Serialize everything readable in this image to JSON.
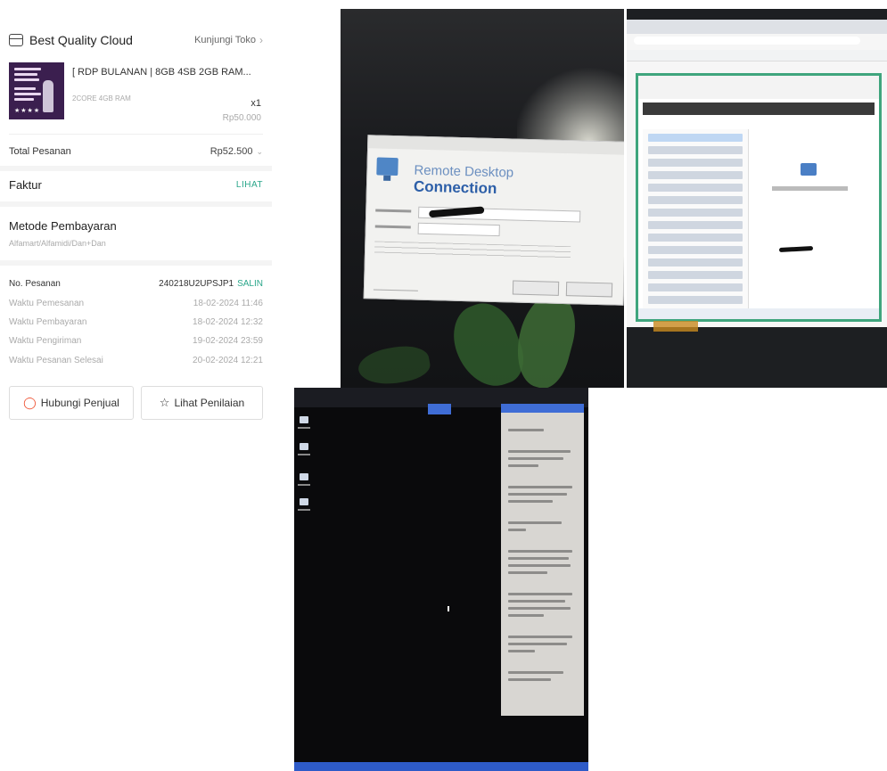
{
  "order": {
    "store_name": "Best Quality Cloud",
    "store_link": "Kunjungi Toko",
    "product": {
      "title": "[ RDP BULANAN | 8GB 4SB 2GB RAM...",
      "variation": "2CORE 4GB RAM",
      "quantity": "x1",
      "price": "Rp50.000"
    },
    "total_label": "Total Pesanan",
    "total_value": "Rp52.500",
    "invoice_label": "Faktur",
    "invoice_action": "LIHAT",
    "payment_title": "Metode Pembayaran",
    "payment_value": "Alfamart/Alfamidi/Dan+Dan",
    "order_info": [
      {
        "label": "No. Pesanan",
        "value": "240218U2UPSJP1"
      },
      {
        "label": "Waktu Pemesanan",
        "value": "18-02-2024 11:46"
      },
      {
        "label": "Waktu Pembayaran",
        "value": "18-02-2024 12:32"
      },
      {
        "label": "Waktu Pengiriman",
        "value": "19-02-2024 23:59"
      },
      {
        "label": "Waktu Pesanan Selesai",
        "value": "20-02-2024 12:21"
      }
    ],
    "copy_label": "SALIN",
    "contact_seller": "Hubungi Penjual",
    "view_rating": "Lihat Penilaian"
  },
  "photo_rdp": {
    "dialog_title_line1": "Remote Desktop",
    "dialog_title_line2": "Connection"
  },
  "colors": {
    "accent_green": "#2aa68a",
    "shopee_orange": "#ee4d2d"
  },
  "icons": [
    "store-icon",
    "chevron-right-icon",
    "chevron-down-icon",
    "chat-icon",
    "star-icon",
    "monitor-icon"
  ]
}
